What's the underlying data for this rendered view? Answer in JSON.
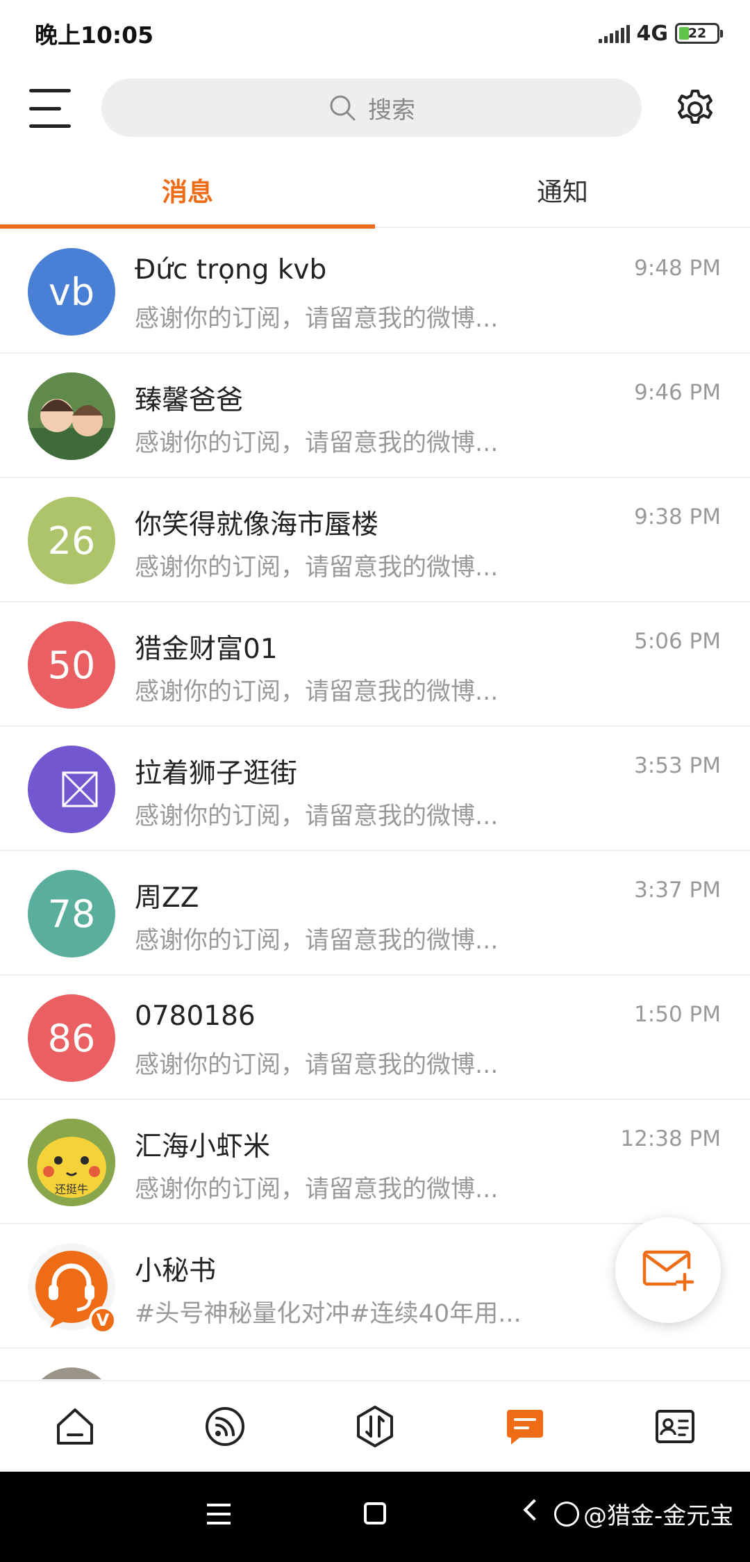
{
  "status_bar": {
    "time": "晚上10:05",
    "network": "4G",
    "battery": "22"
  },
  "search": {
    "placeholder": "搜索"
  },
  "tabs": [
    {
      "label": "消息",
      "active": true
    },
    {
      "label": "通知",
      "active": false
    }
  ],
  "conversations": [
    {
      "name": "Đức trọng kvb",
      "preview": "感谢你的订阅，请留意我的微博...",
      "time": "9:48 PM",
      "avatar_text": "vb",
      "avatar_color": "#4a7fd6"
    },
    {
      "name": "臻馨爸爸",
      "preview": "感谢你的订阅，请留意我的微博...",
      "time": "9:46 PM",
      "avatar_text": "",
      "avatar_color": "#6b8f4a"
    },
    {
      "name": "你笑得就像海市蜃楼",
      "preview": "感谢你的订阅，请留意我的微博...",
      "time": "9:38 PM",
      "avatar_text": "26",
      "avatar_color": "#adc46b"
    },
    {
      "name": "猎金财富01",
      "preview": "感谢你的订阅，请留意我的微博...",
      "time": "5:06 PM",
      "avatar_text": "50",
      "avatar_color": "#ea5f61"
    },
    {
      "name": "拉着狮子逛街",
      "preview": "感谢你的订阅，请留意我的微博...",
      "time": "3:53 PM",
      "avatar_text": "",
      "avatar_color": "#7257d1"
    },
    {
      "name": "周ZZ",
      "preview": "感谢你的订阅，请留意我的微博...",
      "time": "3:37 PM",
      "avatar_text": "78",
      "avatar_color": "#5aaf9c"
    },
    {
      "name": "0780186",
      "preview": "感谢你的订阅，请留意我的微博...",
      "time": "1:50 PM",
      "avatar_text": "86",
      "avatar_color": "#ea5f61"
    },
    {
      "name": "汇海小虾米",
      "preview": "感谢你的订阅，请留意我的微博...",
      "time": "12:38 PM",
      "avatar_text": "还挺牛",
      "avatar_color": "#c8a64a"
    },
    {
      "name": "小秘书",
      "preview": "#头号神秘量化对冲#连续40年用...",
      "time": "",
      "avatar_text": "",
      "avatar_color": "#ee6c16",
      "badge": "V"
    }
  ],
  "bottom_nav": [
    {
      "icon": "home-icon"
    },
    {
      "icon": "feed-icon"
    },
    {
      "icon": "trade-icon"
    },
    {
      "icon": "message-icon",
      "active": true
    },
    {
      "icon": "contact-card-icon"
    }
  ],
  "watermark": "@猎金-金元宝",
  "colors": {
    "accent": "#ee6c16",
    "muted_text": "#999999"
  }
}
